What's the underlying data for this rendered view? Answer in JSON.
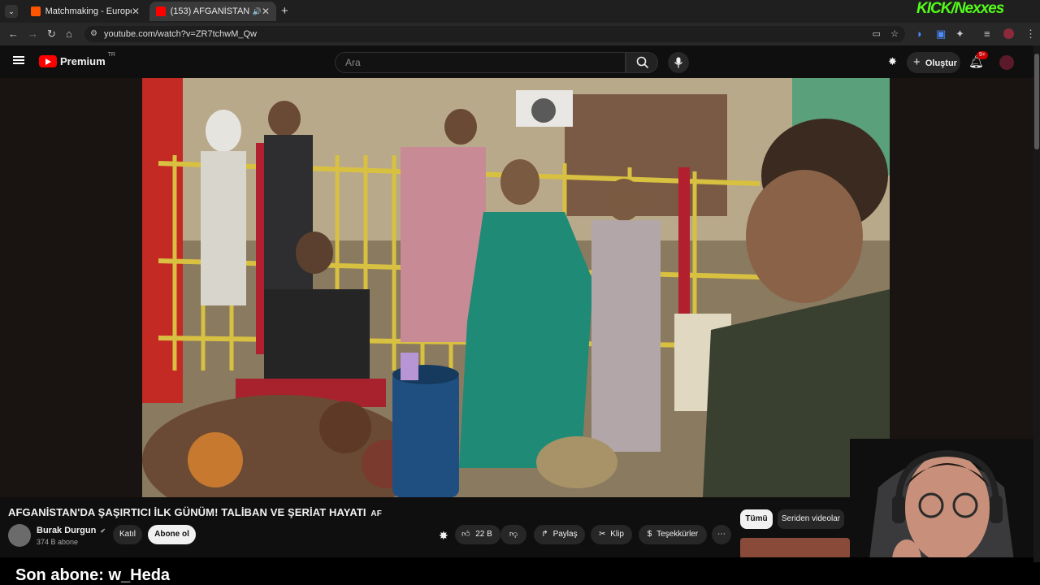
{
  "browser": {
    "tabs": [
      {
        "label": "Matchmaking - Europe 5v5 Qu",
        "active": false
      },
      {
        "label": "(153) AFGANİSTAN'DA ŞAŞ",
        "active": true
      }
    ],
    "url": "youtube.com/watch?v=ZR7tchwM_Qw"
  },
  "youtube": {
    "logo_text": "Premium",
    "region": "TR",
    "search_placeholder": "Ara",
    "create_label": "Oluştur",
    "notifications_badge": "9+"
  },
  "video": {
    "title": "AFGANİSTAN'DA ŞAŞIRTICI İLK GÜNÜM! TALİBAN VE ŞERİAT HAYATI",
    "title_tag": "AF",
    "channel": "Burak Durgun",
    "subscribers": "374 B abone",
    "join_label": "Katıl",
    "subscribe_label": "Abone ol",
    "likes": "22 B",
    "share_label": "Paylaş",
    "clip_label": "Klip",
    "thanks_label": "Teşekkürler"
  },
  "sidebar_chips": [
    "Tümü",
    "Seriden videolar"
  ],
  "stream_overlay": {
    "brand": "KICK/Nexxes",
    "last_sub": "Son abone: w_Heda"
  },
  "colors": {
    "accent": "#ff0000",
    "kick": "#53fc18"
  }
}
